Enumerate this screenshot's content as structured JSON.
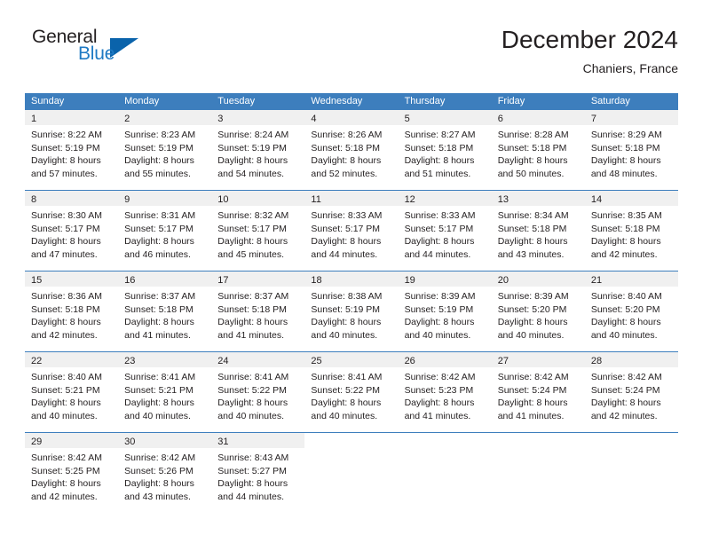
{
  "brand": {
    "name_part1": "General",
    "name_part2": "Blue",
    "triangle_color": "#0a63ab",
    "blue_text_color": "#1f7ac4"
  },
  "header": {
    "title": "December 2024",
    "subtitle": "Chaniers, France"
  },
  "theme": {
    "header_blue": "#3d7ebd",
    "day_band_gray": "#f0f0f0",
    "text_color": "#231f20"
  },
  "weekdays": [
    "Sunday",
    "Monday",
    "Tuesday",
    "Wednesday",
    "Thursday",
    "Friday",
    "Saturday"
  ],
  "weeks": [
    [
      {
        "day": "1",
        "sunrise": "Sunrise: 8:22 AM",
        "sunset": "Sunset: 5:19 PM",
        "daylight_line1": "Daylight: 8 hours",
        "daylight_line2": "and 57 minutes."
      },
      {
        "day": "2",
        "sunrise": "Sunrise: 8:23 AM",
        "sunset": "Sunset: 5:19 PM",
        "daylight_line1": "Daylight: 8 hours",
        "daylight_line2": "and 55 minutes."
      },
      {
        "day": "3",
        "sunrise": "Sunrise: 8:24 AM",
        "sunset": "Sunset: 5:19 PM",
        "daylight_line1": "Daylight: 8 hours",
        "daylight_line2": "and 54 minutes."
      },
      {
        "day": "4",
        "sunrise": "Sunrise: 8:26 AM",
        "sunset": "Sunset: 5:18 PM",
        "daylight_line1": "Daylight: 8 hours",
        "daylight_line2": "and 52 minutes."
      },
      {
        "day": "5",
        "sunrise": "Sunrise: 8:27 AM",
        "sunset": "Sunset: 5:18 PM",
        "daylight_line1": "Daylight: 8 hours",
        "daylight_line2": "and 51 minutes."
      },
      {
        "day": "6",
        "sunrise": "Sunrise: 8:28 AM",
        "sunset": "Sunset: 5:18 PM",
        "daylight_line1": "Daylight: 8 hours",
        "daylight_line2": "and 50 minutes."
      },
      {
        "day": "7",
        "sunrise": "Sunrise: 8:29 AM",
        "sunset": "Sunset: 5:18 PM",
        "daylight_line1": "Daylight: 8 hours",
        "daylight_line2": "and 48 minutes."
      }
    ],
    [
      {
        "day": "8",
        "sunrise": "Sunrise: 8:30 AM",
        "sunset": "Sunset: 5:17 PM",
        "daylight_line1": "Daylight: 8 hours",
        "daylight_line2": "and 47 minutes."
      },
      {
        "day": "9",
        "sunrise": "Sunrise: 8:31 AM",
        "sunset": "Sunset: 5:17 PM",
        "daylight_line1": "Daylight: 8 hours",
        "daylight_line2": "and 46 minutes."
      },
      {
        "day": "10",
        "sunrise": "Sunrise: 8:32 AM",
        "sunset": "Sunset: 5:17 PM",
        "daylight_line1": "Daylight: 8 hours",
        "daylight_line2": "and 45 minutes."
      },
      {
        "day": "11",
        "sunrise": "Sunrise: 8:33 AM",
        "sunset": "Sunset: 5:17 PM",
        "daylight_line1": "Daylight: 8 hours",
        "daylight_line2": "and 44 minutes."
      },
      {
        "day": "12",
        "sunrise": "Sunrise: 8:33 AM",
        "sunset": "Sunset: 5:17 PM",
        "daylight_line1": "Daylight: 8 hours",
        "daylight_line2": "and 44 minutes."
      },
      {
        "day": "13",
        "sunrise": "Sunrise: 8:34 AM",
        "sunset": "Sunset: 5:18 PM",
        "daylight_line1": "Daylight: 8 hours",
        "daylight_line2": "and 43 minutes."
      },
      {
        "day": "14",
        "sunrise": "Sunrise: 8:35 AM",
        "sunset": "Sunset: 5:18 PM",
        "daylight_line1": "Daylight: 8 hours",
        "daylight_line2": "and 42 minutes."
      }
    ],
    [
      {
        "day": "15",
        "sunrise": "Sunrise: 8:36 AM",
        "sunset": "Sunset: 5:18 PM",
        "daylight_line1": "Daylight: 8 hours",
        "daylight_line2": "and 42 minutes."
      },
      {
        "day": "16",
        "sunrise": "Sunrise: 8:37 AM",
        "sunset": "Sunset: 5:18 PM",
        "daylight_line1": "Daylight: 8 hours",
        "daylight_line2": "and 41 minutes."
      },
      {
        "day": "17",
        "sunrise": "Sunrise: 8:37 AM",
        "sunset": "Sunset: 5:18 PM",
        "daylight_line1": "Daylight: 8 hours",
        "daylight_line2": "and 41 minutes."
      },
      {
        "day": "18",
        "sunrise": "Sunrise: 8:38 AM",
        "sunset": "Sunset: 5:19 PM",
        "daylight_line1": "Daylight: 8 hours",
        "daylight_line2": "and 40 minutes."
      },
      {
        "day": "19",
        "sunrise": "Sunrise: 8:39 AM",
        "sunset": "Sunset: 5:19 PM",
        "daylight_line1": "Daylight: 8 hours",
        "daylight_line2": "and 40 minutes."
      },
      {
        "day": "20",
        "sunrise": "Sunrise: 8:39 AM",
        "sunset": "Sunset: 5:20 PM",
        "daylight_line1": "Daylight: 8 hours",
        "daylight_line2": "and 40 minutes."
      },
      {
        "day": "21",
        "sunrise": "Sunrise: 8:40 AM",
        "sunset": "Sunset: 5:20 PM",
        "daylight_line1": "Daylight: 8 hours",
        "daylight_line2": "and 40 minutes."
      }
    ],
    [
      {
        "day": "22",
        "sunrise": "Sunrise: 8:40 AM",
        "sunset": "Sunset: 5:21 PM",
        "daylight_line1": "Daylight: 8 hours",
        "daylight_line2": "and 40 minutes."
      },
      {
        "day": "23",
        "sunrise": "Sunrise: 8:41 AM",
        "sunset": "Sunset: 5:21 PM",
        "daylight_line1": "Daylight: 8 hours",
        "daylight_line2": "and 40 minutes."
      },
      {
        "day": "24",
        "sunrise": "Sunrise: 8:41 AM",
        "sunset": "Sunset: 5:22 PM",
        "daylight_line1": "Daylight: 8 hours",
        "daylight_line2": "and 40 minutes."
      },
      {
        "day": "25",
        "sunrise": "Sunrise: 8:41 AM",
        "sunset": "Sunset: 5:22 PM",
        "daylight_line1": "Daylight: 8 hours",
        "daylight_line2": "and 40 minutes."
      },
      {
        "day": "26",
        "sunrise": "Sunrise: 8:42 AM",
        "sunset": "Sunset: 5:23 PM",
        "daylight_line1": "Daylight: 8 hours",
        "daylight_line2": "and 41 minutes."
      },
      {
        "day": "27",
        "sunrise": "Sunrise: 8:42 AM",
        "sunset": "Sunset: 5:24 PM",
        "daylight_line1": "Daylight: 8 hours",
        "daylight_line2": "and 41 minutes."
      },
      {
        "day": "28",
        "sunrise": "Sunrise: 8:42 AM",
        "sunset": "Sunset: 5:24 PM",
        "daylight_line1": "Daylight: 8 hours",
        "daylight_line2": "and 42 minutes."
      }
    ],
    [
      {
        "day": "29",
        "sunrise": "Sunrise: 8:42 AM",
        "sunset": "Sunset: 5:25 PM",
        "daylight_line1": "Daylight: 8 hours",
        "daylight_line2": "and 42 minutes."
      },
      {
        "day": "30",
        "sunrise": "Sunrise: 8:42 AM",
        "sunset": "Sunset: 5:26 PM",
        "daylight_line1": "Daylight: 8 hours",
        "daylight_line2": "and 43 minutes."
      },
      {
        "day": "31",
        "sunrise": "Sunrise: 8:43 AM",
        "sunset": "Sunset: 5:27 PM",
        "daylight_line1": "Daylight: 8 hours",
        "daylight_line2": "and 44 minutes."
      },
      {
        "day": "",
        "sunrise": "",
        "sunset": "",
        "daylight_line1": "",
        "daylight_line2": ""
      },
      {
        "day": "",
        "sunrise": "",
        "sunset": "",
        "daylight_line1": "",
        "daylight_line2": ""
      },
      {
        "day": "",
        "sunrise": "",
        "sunset": "",
        "daylight_line1": "",
        "daylight_line2": ""
      },
      {
        "day": "",
        "sunrise": "",
        "sunset": "",
        "daylight_line1": "",
        "daylight_line2": ""
      }
    ]
  ]
}
